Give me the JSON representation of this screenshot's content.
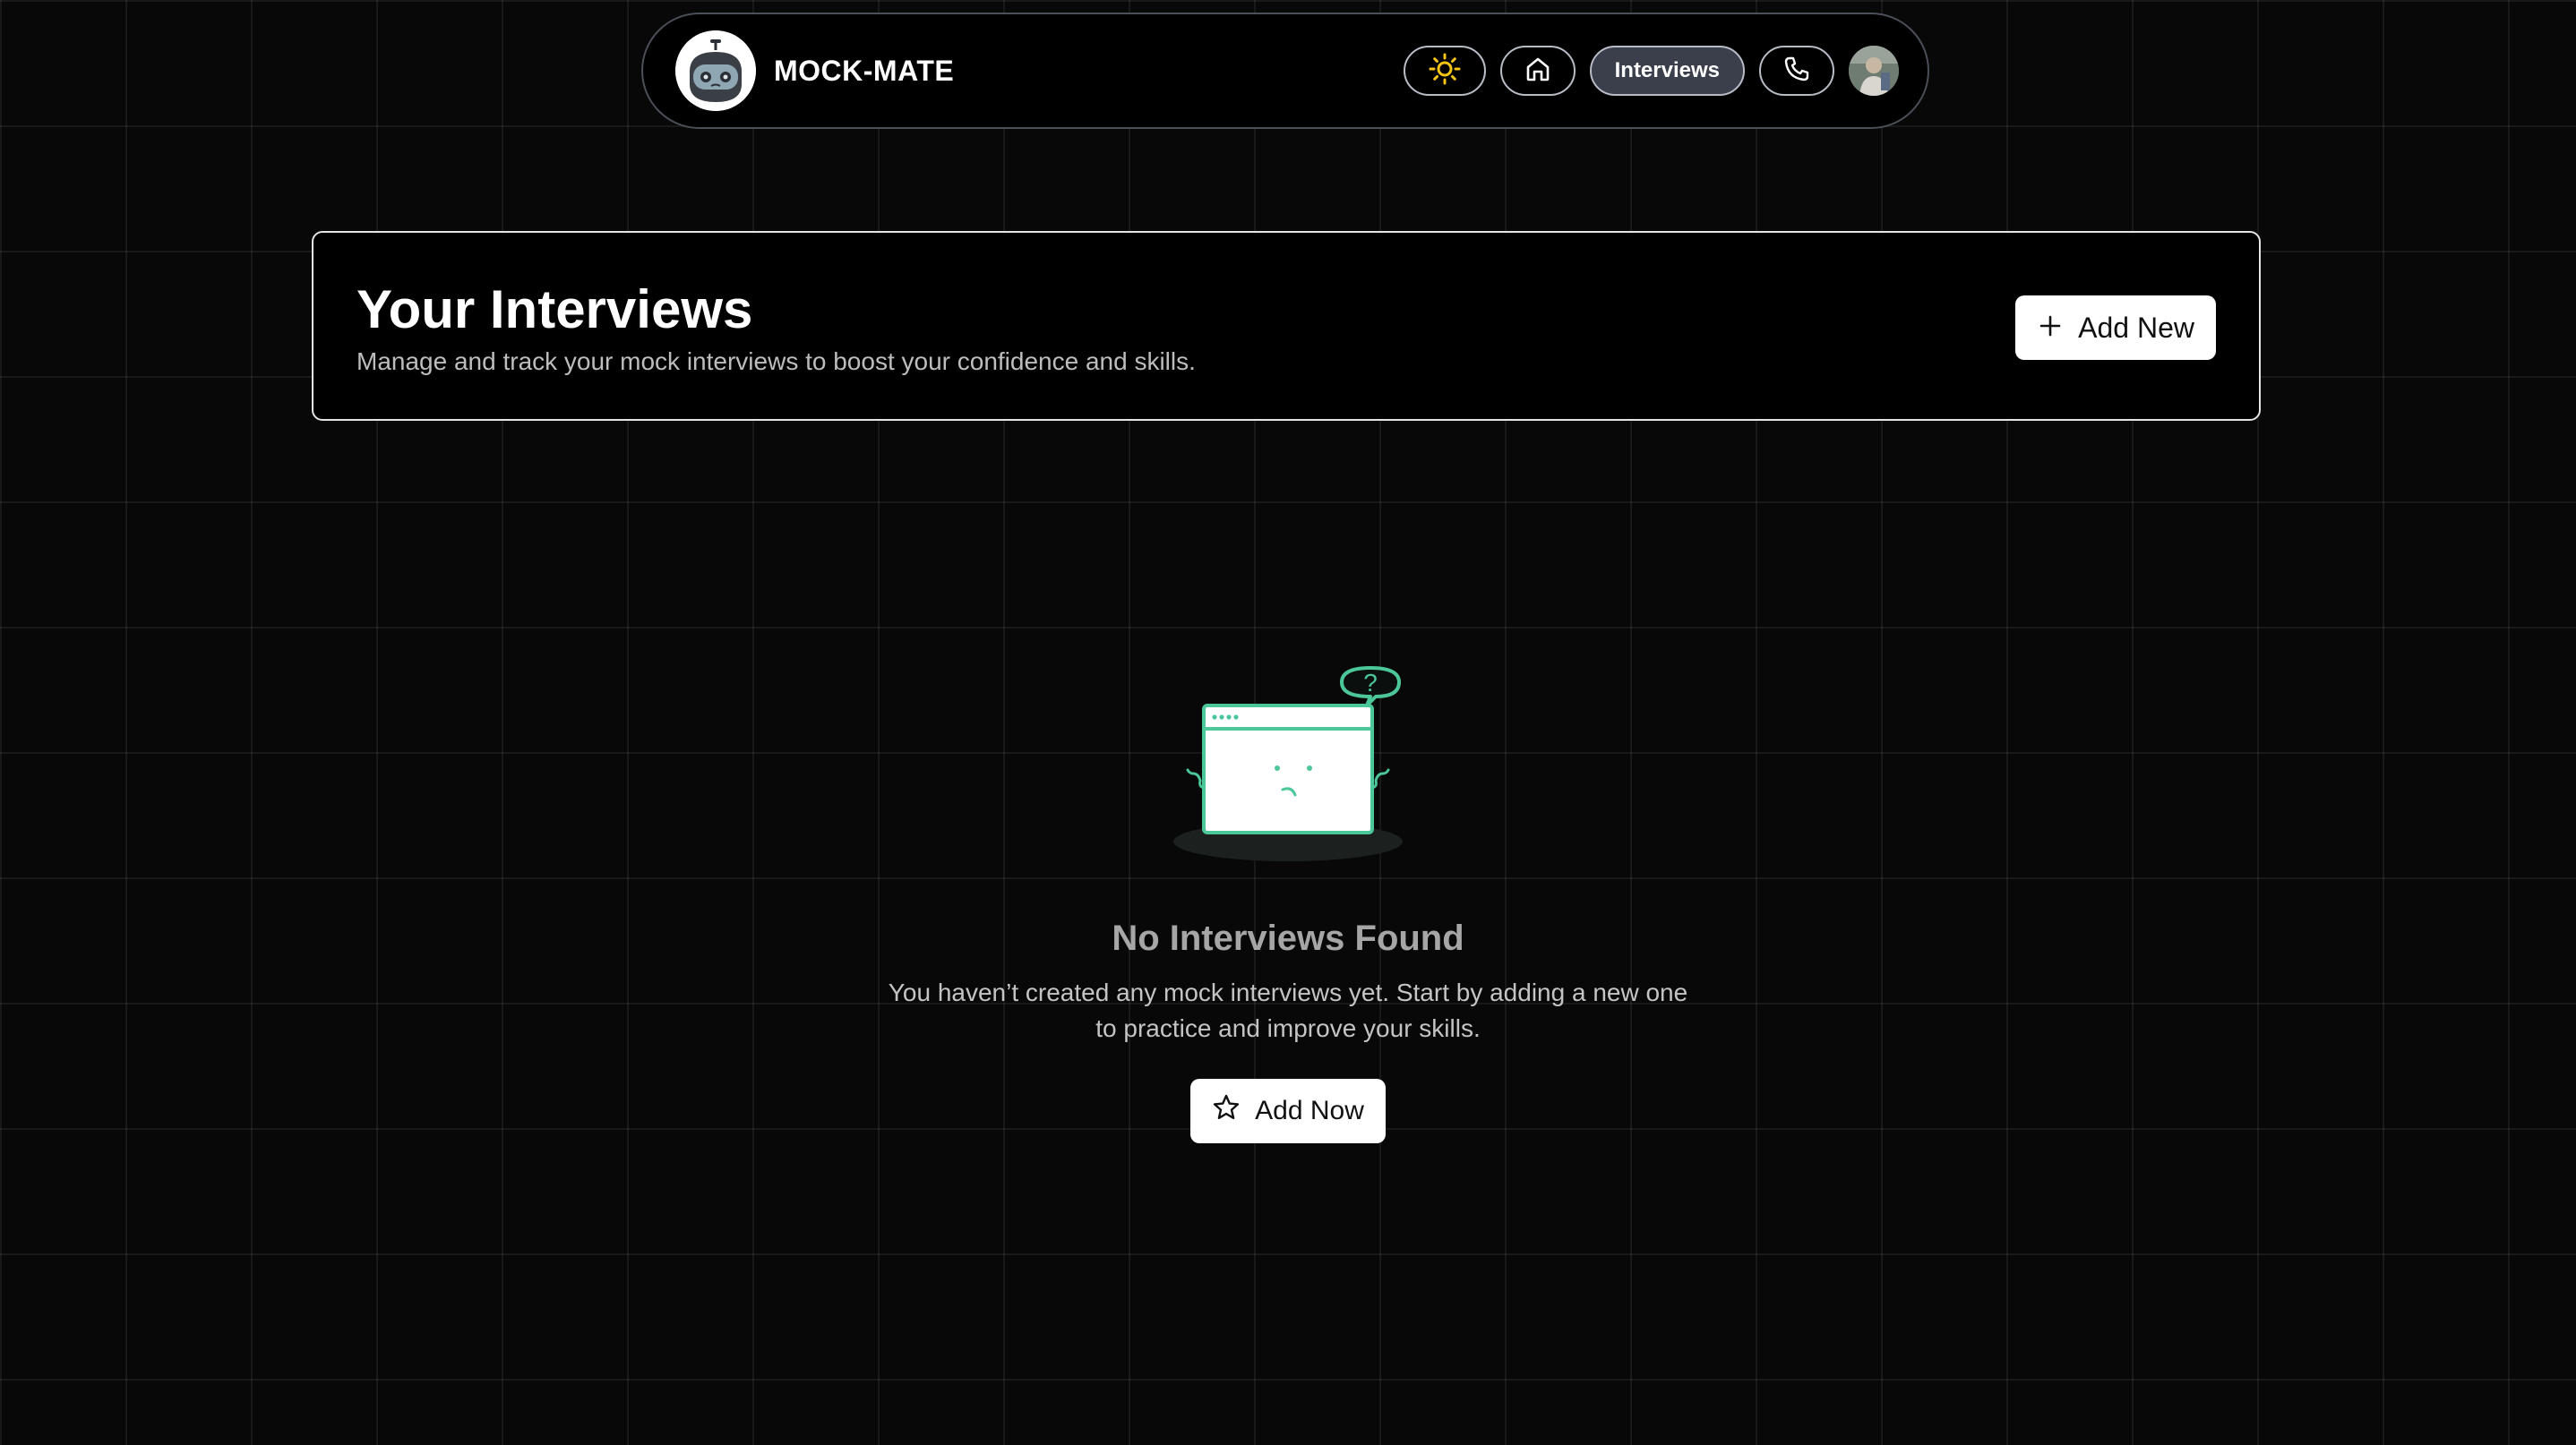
{
  "app": {
    "brand_name": "MOCK-MATE",
    "logo_icon": "robot-face-icon"
  },
  "nav": {
    "theme_toggle_icon": "sun-icon",
    "home_icon": "home-icon",
    "interviews_label": "Interviews",
    "contact_icon": "phone-icon",
    "avatar_icon": "user-avatar"
  },
  "header": {
    "title": "Your Interviews",
    "subtitle": "Manage and track your mock interviews to boost your confidence and skills.",
    "add_button_label": "Add New",
    "add_button_icon": "plus-icon"
  },
  "empty_state": {
    "illustration": "confused-browser-window-illustration",
    "title": "No Interviews Found",
    "description": "You haven’t created any mock interviews yet. Start by adding a new one to practice and improve your skills.",
    "button_label": "Add Now",
    "button_icon": "star-icon"
  },
  "colors": {
    "background": "#080808",
    "accent_green": "#4cc79a",
    "sun_yellow": "#f5c518",
    "active_pill": "#3a3f4b"
  }
}
